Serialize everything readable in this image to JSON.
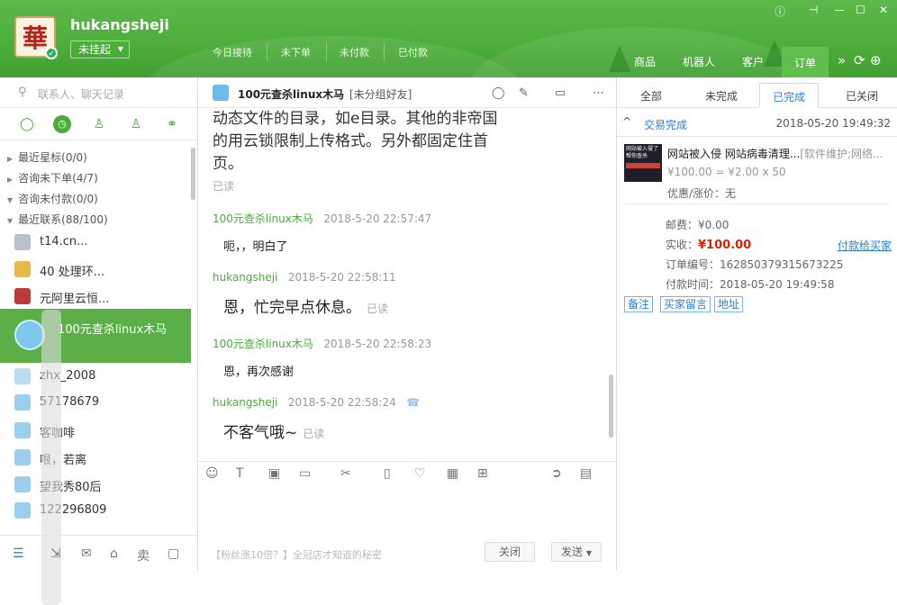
{
  "header": {
    "logo_char": "華",
    "username": "hukangsheji",
    "status": "未挂起",
    "stats": [
      "今日接待",
      "未下单",
      "未付款",
      "已付款"
    ],
    "nav": [
      "商品",
      "机器人",
      "客户",
      "订单"
    ],
    "active_nav": "订单"
  },
  "left": {
    "search_placeholder": "联系人、聊天记录",
    "groups": [
      "最近星标(0/0)",
      "咨询未下单(4/7)",
      "咨询未付款(0/0)",
      "最近联系(88/100)"
    ],
    "contacts": [
      "t14.cn...",
      "40 处理环...",
      "元阿里云恒...",
      "100元查杀linux木马",
      "zhx_2008",
      "57178679",
      "客咖啡",
      "哏，若离",
      "望我秀80后",
      "122296809"
    ],
    "bottom_sell_label": "卖"
  },
  "chat": {
    "title": "100元查杀linux木马",
    "group_tag": "[未分组好友]",
    "messages": [
      {
        "sender": "",
        "time": "",
        "lines": [
          "动态文件的目录，如e目录。其他的非帝国",
          "的用云锁限制上传格式。另外都固定住首",
          "页。"
        ],
        "read": "已读"
      },
      {
        "sender": "100元查杀linux木马",
        "time": "2018-5-20 22:57:47",
        "lines": [
          "呃，，明白了"
        ],
        "read": ""
      },
      {
        "sender": "hukangsheji",
        "time": "2018-5-20 22:58:11",
        "lines": [
          "恩，忙完早点休息。"
        ],
        "read": "已读"
      },
      {
        "sender": "100元查杀linux木马",
        "time": "2018-5-20 22:58:23",
        "lines": [
          "恩，再次感谢"
        ],
        "read": ""
      },
      {
        "sender": "hukangsheji",
        "time": "2018-5-20 22:58:24",
        "lines": [
          "不客气哦~"
        ],
        "read": "已读"
      }
    ],
    "ad_text": "【粉丝涨10倍？】全冠店才知道的秘密",
    "close_button": "关闭",
    "send_button": "发送"
  },
  "order": {
    "tabs": [
      "全部",
      "未完成",
      "已完成",
      "已关闭"
    ],
    "active_tab": "已完成",
    "status": "交易完成",
    "time": "2018-05-20 19:49:32",
    "product_image_text": "网站被入侵了 帮你查杀",
    "product_title": "网站被入侵 网站病毒清理...",
    "product_category": "[软件维护;网络...",
    "price_line": "¥100.00 = ¥2.00 x 50",
    "discount_label": "优惠/涨价：",
    "discount_value": "无",
    "postage": "邮费：¥0.00",
    "paid_label": "实收：",
    "paid_value": "¥100.00",
    "pay_link": "付款给买家",
    "order_no": "订单编号：162850379315673225",
    "pay_time": "付款时间：2018-05-20 19:49:58",
    "tags": [
      "备注",
      "买家留言",
      "地址"
    ]
  }
}
